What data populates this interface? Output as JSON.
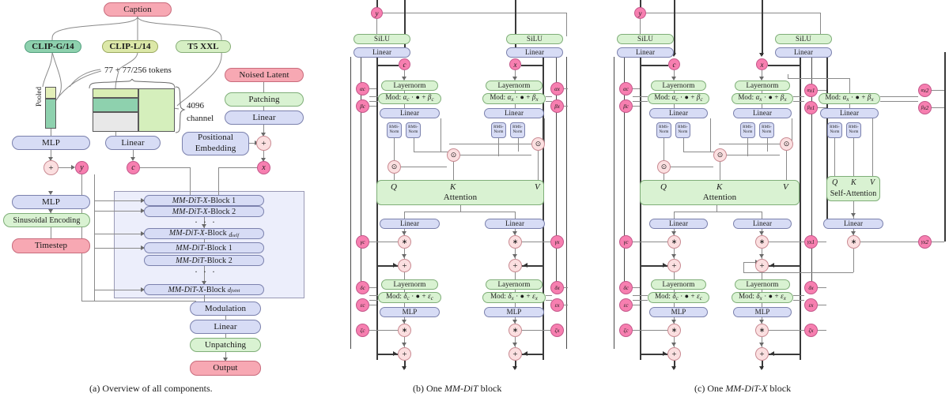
{
  "figure": {
    "captions": {
      "a": "(a) Overview of all components.",
      "b": "(b) One MM-DiT block",
      "c": "(c) One MM-DiT-X block"
    }
  },
  "colors": {
    "pink": "#f7a8b3",
    "blue": "#d7dcf5",
    "green": "#d9f2d2",
    "clip_g": "#8ed1ae",
    "clip_l": "#dce8a8",
    "t5": "#d6efc4",
    "circle_var": "#f77fb0",
    "circle_op": "#fbdfe0",
    "panel_fill": "#eceefb"
  },
  "overview": {
    "caption_box": "Caption",
    "encoders": [
      "CLIP-G/14",
      "CLIP-L/14",
      "T5 XXL"
    ],
    "tokens_label": "77 + 77/256 tokens",
    "channel_label_line1": "4096",
    "channel_label_line2": "channel",
    "pooled_label": "Pooled",
    "noised_latent": "Noised Latent",
    "patching": "Patching",
    "linear_latent": "Linear",
    "positional_embedding_line1": "Positional",
    "positional_embedding_line2": "Embedding",
    "mlp_pooled": "MLP",
    "linear_context": "Linear",
    "var_y": "y",
    "var_c": "c",
    "var_x": "x",
    "plus": "+",
    "mlp_time": "MLP",
    "sinusoidal": "Sinusoidal Encoding",
    "timestep": "Timestep",
    "blocks": [
      "MM-DiT-X-Block 1",
      "MM-DiT-X-Block 2",
      "MM-DiT-X-Block d_self",
      "MM-DiT-Block 1",
      "MM-DiT-Block 2",
      "MM-DiT-X-Block d_joint"
    ],
    "ellipsis": "· · ·",
    "modulation": "Modulation",
    "linear_out": "Linear",
    "unpatching": "Unpatching",
    "output": "Output"
  },
  "mmdit": {
    "var_y": "y",
    "silu": "SiLU",
    "linear_mod": "Linear",
    "var_c": "c",
    "var_x": "x",
    "layernorm": "Layernorm",
    "mod_c": "Mod: α_c · ● + β_c",
    "mod_x": "Mod: α_x · ● + β_x",
    "linear_qkv": "Linear",
    "rmsnorm_line1": "RMS-",
    "rmsnorm_line2": "Norm",
    "attention": "Attention",
    "q": "Q",
    "k": "K",
    "v": "V",
    "linear_proj": "Linear",
    "mlp": "MLP",
    "mod_mlp_c": "Mod: δ_c · ● + ε_c",
    "mod_mlp_x": "Mod: δ_x · ● + ε_x",
    "op_mul": "∗",
    "op_add": "+",
    "op_odot": "⊙",
    "params_c": [
      "α_c",
      "β_c",
      "γ_c",
      "δ_c",
      "ε_c",
      "ζ_c"
    ],
    "params_x": [
      "α_x",
      "β_x",
      "γ_x",
      "δ_x",
      "ε_x",
      "ζ_x"
    ]
  },
  "mmditx": {
    "var_y": "y",
    "silu": "SiLU",
    "linear_mod": "Linear",
    "var_c": "c",
    "var_x": "x",
    "layernorm": "Layernorm",
    "mod_c": "Mod: α_c · ● + β_c",
    "mod_x": "Mod: α_x · ● + β_x",
    "mod_selfattn": "Mod: α_x · ● + β_x",
    "linear_qkv": "Linear",
    "rmsnorm_line1": "RMS-",
    "rmsnorm_line2": "Norm",
    "attention": "Attention",
    "self_attention": "Self-Attention",
    "q": "Q",
    "k": "K",
    "v": "V",
    "linear_proj": "Linear",
    "mlp": "MLP",
    "mod_mlp_c": "Mod: δ_c · ● + ε_c",
    "mod_mlp_x": "Mod: δ_x · ● + ε_x",
    "op_mul": "∗",
    "op_add": "+",
    "op_odot": "⊙",
    "params_c": [
      "α_c",
      "β_c",
      "γ_c",
      "δ_c",
      "ε_c",
      "ζ_c"
    ],
    "params_x": [
      "α_x",
      "β_x",
      "γ_x",
      "δ_x",
      "ε_x",
      "ζ_x"
    ],
    "params_x1": [
      "α_x1",
      "β_x1",
      "γ_x1"
    ],
    "params_x2": [
      "α_x2",
      "β_x2",
      "γ_x2"
    ]
  }
}
